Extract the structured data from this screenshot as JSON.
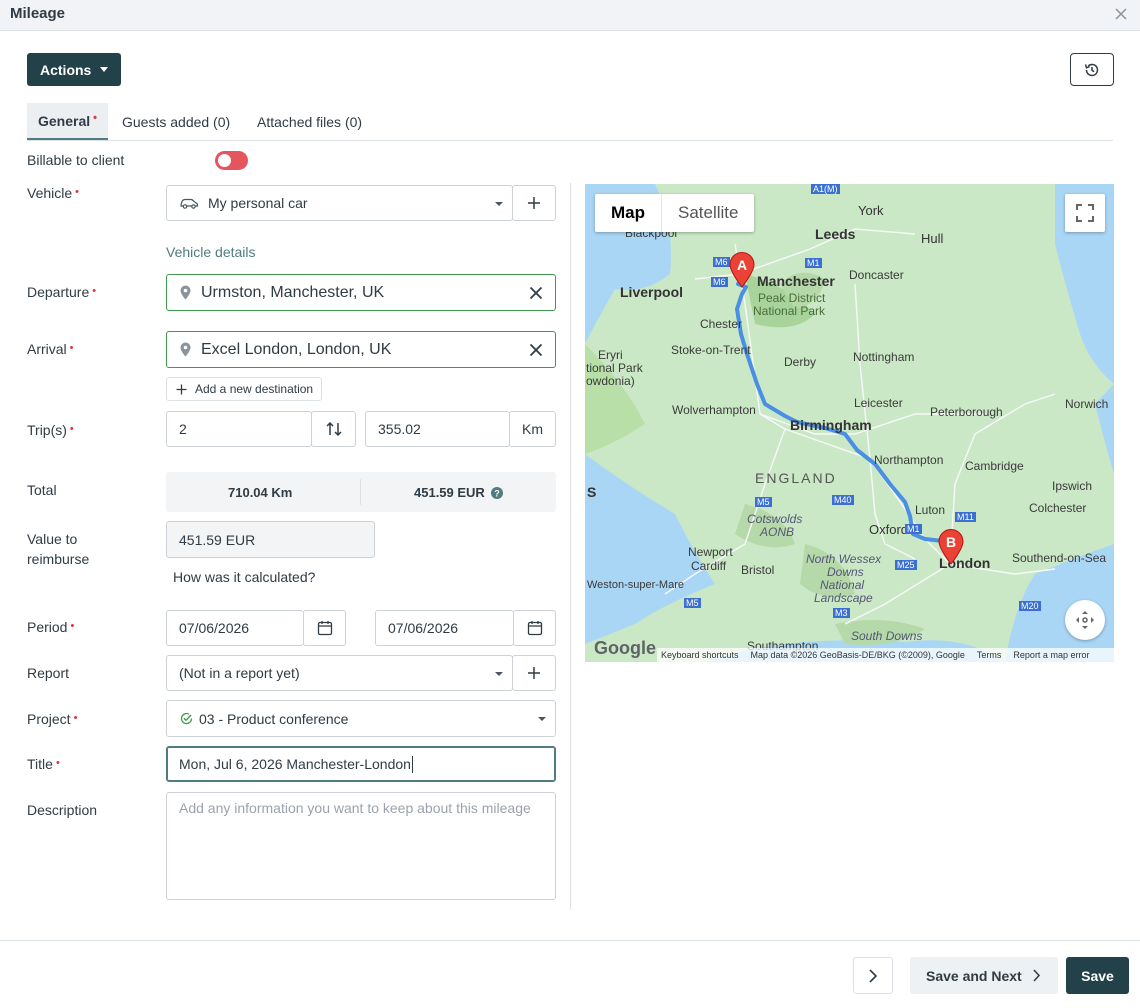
{
  "window": {
    "title": "Mileage"
  },
  "toolbar": {
    "actions_label": "Actions"
  },
  "tabs": [
    {
      "label": "General",
      "required": "•"
    },
    {
      "label": "Guests added (0)"
    },
    {
      "label": "Attached files (0)"
    }
  ],
  "form": {
    "billable": {
      "label": "Billable to client",
      "on": false
    },
    "vehicle": {
      "label": "Vehicle",
      "value": "My personal car",
      "details_link": "Vehicle details"
    },
    "departure": {
      "label": "Departure",
      "value": "Urmston, Manchester, UK"
    },
    "arrival": {
      "label": "Arrival",
      "value": "Excel London, London, UK"
    },
    "add_destination": "Add a new destination",
    "trips": {
      "label": "Trip(s)",
      "count": "2",
      "distance": "355.02",
      "unit": "Km"
    },
    "total": {
      "label": "Total",
      "distance": "710.04 Km",
      "amount": "451.59 EUR"
    },
    "reimburse": {
      "label_line1": "Value to",
      "label_line2": "reimburse",
      "value": "451.59 EUR",
      "calc_link": "How was it calculated?"
    },
    "period": {
      "label": "Period",
      "from": "07/06/2026",
      "to": "07/06/2026"
    },
    "report": {
      "label": "Report",
      "value": "(Not in a report yet)"
    },
    "project": {
      "label": "Project",
      "value": "03 - Product conference"
    },
    "title": {
      "label": "Title",
      "value": "Mon, Jul 6, 2026 Manchester-London"
    },
    "description": {
      "label": "Description",
      "placeholder": "Add any information you want to keep about this mileage"
    },
    "required_mark": "•"
  },
  "map": {
    "type_map": "Map",
    "type_satellite": "Satellite",
    "marker_a": "A",
    "marker_b": "B",
    "google": "Google",
    "attribution": {
      "shortcuts": "Keyboard shortcuts",
      "data": "Map data ©2026 GeoBasis-DE/BKG (©2009), Google",
      "terms": "Terms",
      "report": "Report a map error"
    },
    "places": {
      "york": "York",
      "leeds": "Leeds",
      "hull": "Hull",
      "blackpool": "Blackpool",
      "manchester": "Manchester",
      "doncaster": "Doncaster",
      "liverpool": "Liverpool",
      "peak": "Peak District",
      "peak2": "National Park",
      "chester": "Chester",
      "eryri1": "Eryri",
      "eryri2": "tional Park",
      "eryri3": "owdonia)",
      "stoke": "Stoke-on-Trent",
      "derby": "Derby",
      "nottingham": "Nottingham",
      "leicester": "Leicester",
      "peterborough": "Peterborough",
      "norwich": "Norwich",
      "wolverhampton": "Wolverhampton",
      "birmingham": "Birmingham",
      "northampton": "Northampton",
      "cambridge": "Cambridge",
      "england": "ENGLAND",
      "ipswich": "Ipswich",
      "luton": "Luton",
      "colchester": "Colchester",
      "cotswolds1": "Cotswolds",
      "cotswolds2": "AONB",
      "oxford": "Oxford",
      "newport": "Newport",
      "cardiff": "Cardiff",
      "bristol": "Bristol",
      "nwessex1": "North Wessex",
      "nwessex2": "Downs",
      "nwessex3": "National",
      "nwessex4": "Landscape",
      "london": "London",
      "southend": "Southend-on-Sea",
      "weston": "Weston-super-Mare",
      "southampton": "Southampton",
      "southdowns": "South Downs",
      "s": "S",
      "m6": "M6",
      "m62": "M62",
      "m1": "M1",
      "m5": "M5",
      "m40": "M40",
      "m11": "M11",
      "m25": "M25",
      "m3": "M3",
      "m20": "M20",
      "a1m": "A1(M)"
    }
  },
  "footer": {
    "save_next": "Save and Next",
    "save": "Save"
  }
}
